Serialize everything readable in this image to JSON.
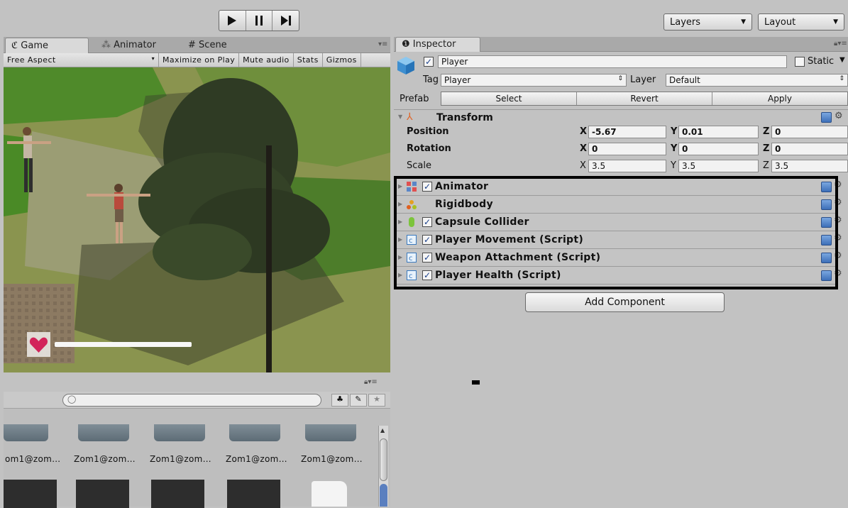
{
  "toolbar": {
    "play_icon": "play-icon",
    "pause_icon": "pause-icon",
    "step_icon": "step-icon",
    "layers_label": "Layers",
    "layout_label": "Layout"
  },
  "game_panel": {
    "tabs": [
      {
        "label": "Game",
        "icon": "game-icon"
      },
      {
        "label": "Animator",
        "icon": "animator-icon"
      },
      {
        "label": "Scene",
        "icon": "scene-icon"
      }
    ],
    "aspect": "Free Aspect",
    "maximize_on_play": "Maximize on Play",
    "mute_audio": "Mute audio",
    "stats": "Stats",
    "gizmos": "Gizmos",
    "health_fraction": 0.85
  },
  "project_panel": {
    "assets": [
      "om1@zom…",
      "Zom1@zom…",
      "Zom1@zom…",
      "Zom1@zom…",
      "Zom1@zom…"
    ]
  },
  "inspector": {
    "tab_label": "Inspector",
    "object_name": "Player",
    "static_label": "Static",
    "tag_label": "Tag",
    "tag_value": "Player",
    "layer_label": "Layer",
    "layer_value": "Default",
    "prefab_label": "Prefab",
    "prefab_select": "Select",
    "prefab_revert": "Revert",
    "prefab_apply": "Apply",
    "transform": {
      "title": "Transform",
      "position_label": "Position",
      "rotation_label": "Rotation",
      "scale_label": "Scale",
      "position": {
        "x": "-5.67",
        "y": "0.01",
        "z": "0"
      },
      "rotation": {
        "x": "0",
        "y": "0",
        "z": "0"
      },
      "scale": {
        "x": "3.5",
        "y": "3.5",
        "z": "3.5"
      }
    },
    "components": [
      {
        "name": "Animator",
        "icon": "animator-component-icon",
        "checkbox": true
      },
      {
        "name": "Rigidbody",
        "icon": "rigidbody-icon",
        "checkbox": false
      },
      {
        "name": "Capsule Collider",
        "icon": "capsule-collider-icon",
        "checkbox": true
      },
      {
        "name": "Player Movement (Script)",
        "icon": "script-icon",
        "checkbox": true
      },
      {
        "name": "Weapon Attachment (Script)",
        "icon": "script-icon",
        "checkbox": true
      },
      {
        "name": "Player Health (Script)",
        "icon": "script-icon",
        "checkbox": true
      }
    ],
    "add_component_label": "Add Component"
  },
  "colors": {
    "editor_bg": "#c2c2c2",
    "highlight_border": "#000000",
    "help_icon_blue": "#3d6fb8"
  }
}
